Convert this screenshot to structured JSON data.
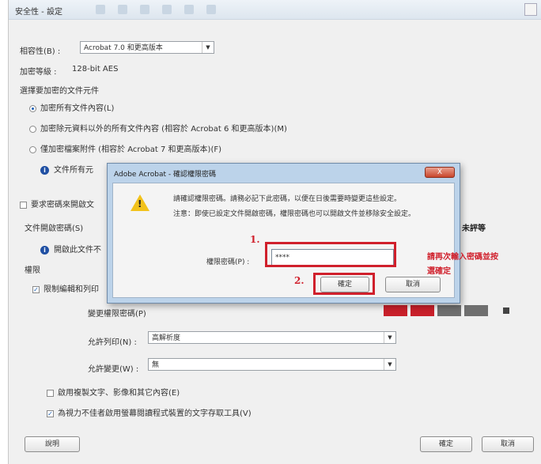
{
  "window": {
    "title": "安全性 - 設定"
  },
  "compat": {
    "label": "相容性(B) :",
    "value": "Acrobat 7.0 和更高版本"
  },
  "encryption": {
    "label": "加密等級 :",
    "value": "128-bit AES"
  },
  "select_docs": {
    "heading": "選擇要加密的文件元件"
  },
  "radios": [
    "加密所有文件內容(L)",
    "加密除元資料以外的所有文件內容 (相容於 Acrobat 6 和更高版本)(M)",
    "僅加密檔案附件 (相容於 Acrobat 7 和更高版本)(F)"
  ],
  "info_note": "文件所有元",
  "require_open": {
    "label": "要求密碼來開啟文",
    "pw_label": "文件開啟密碼(S)",
    "strength_label": "未評等"
  },
  "perm_note": "開啟此文件不",
  "permissions": {
    "heading": "權限",
    "restrict": "限制編輯和列印",
    "change_label": "變更權限密碼(P)",
    "print_label": "允許列印(N) :",
    "print_value": "高解析度",
    "changes_label": "允許變更(W) :",
    "changes_value": "無",
    "copy_text": "啟用複製文字、影像和其它內容(E)",
    "screen_reader": "為視力不佳者啟用螢幕閱讀程式裝置的文字存取工具(V)"
  },
  "buttons": {
    "help": "說明",
    "ok": "確定",
    "cancel": "取消"
  },
  "dialog": {
    "title": "Adobe Acrobat - 確認權限密碼",
    "close": "X",
    "message1": "請確認權限密碼。請務必記下此密碼，以便在日後需要時變更這些設定。",
    "message2": "注意：即使已設定文件開啟密碼，權限密碼也可以開啟文件並移除安全設定。",
    "pw_label": "權限密碼(P) :",
    "pw_value": "****",
    "ok": "確定",
    "cancel": "取消"
  },
  "annotations": {
    "step1": "1.",
    "step2": "2.",
    "note_line1": "請再次輸入密碼並按",
    "note_line2": "選確定"
  },
  "colors": {
    "strength_red": "#c8202a",
    "strength_gray": "#6f6f6f",
    "annotation_red": "#d0202c"
  }
}
